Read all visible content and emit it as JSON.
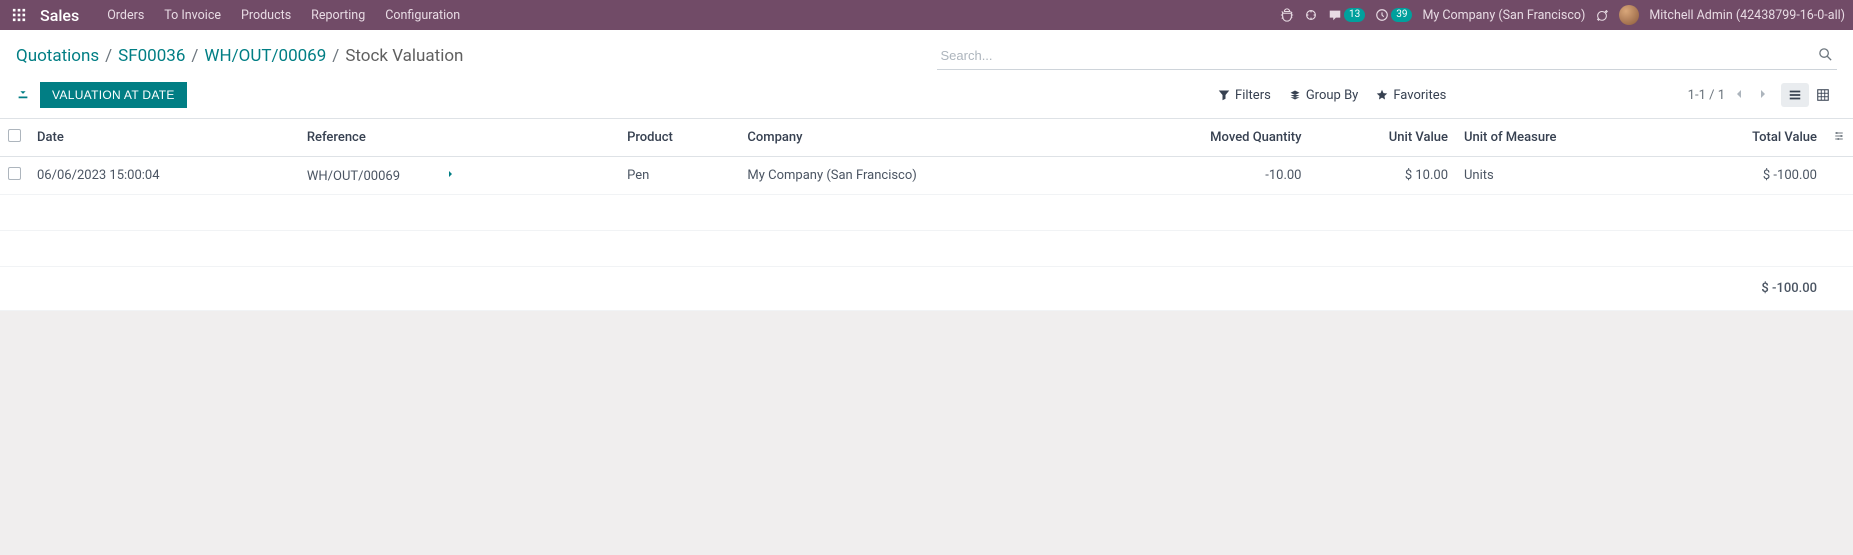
{
  "topbar": {
    "brand": "Sales",
    "menu": [
      "Orders",
      "To Invoice",
      "Products",
      "Reporting",
      "Configuration"
    ],
    "messages_badge": "13",
    "activities_badge": "39",
    "company": "My Company (San Francisco)",
    "username": "Mitchell Admin (42438799-16-0-all)"
  },
  "breadcrumb": {
    "items": [
      "Quotations",
      "SF00036",
      "WH/OUT/00069"
    ],
    "current": "Stock Valuation"
  },
  "search": {
    "placeholder": "Search..."
  },
  "actions": {
    "valuation_btn": "Valuation at Date"
  },
  "search_options": {
    "filters": "Filters",
    "groupby": "Group By",
    "favorites": "Favorites"
  },
  "pager": {
    "value": "1-1 / 1"
  },
  "table": {
    "headers": {
      "date": "Date",
      "reference": "Reference",
      "product": "Product",
      "company": "Company",
      "moved_qty": "Moved Quantity",
      "unit_value": "Unit Value",
      "uom": "Unit of Measure",
      "total_value": "Total Value"
    },
    "rows": [
      {
        "date": "06/06/2023 15:00:04",
        "reference": "WH/OUT/00069",
        "product": "Pen",
        "company": "My Company (San Francisco)",
        "moved_qty": "-10.00",
        "unit_value": "$ 10.00",
        "uom": "Units",
        "total_value": "$ -100.00"
      }
    ],
    "footer": {
      "total_value": "$ -100.00"
    }
  }
}
